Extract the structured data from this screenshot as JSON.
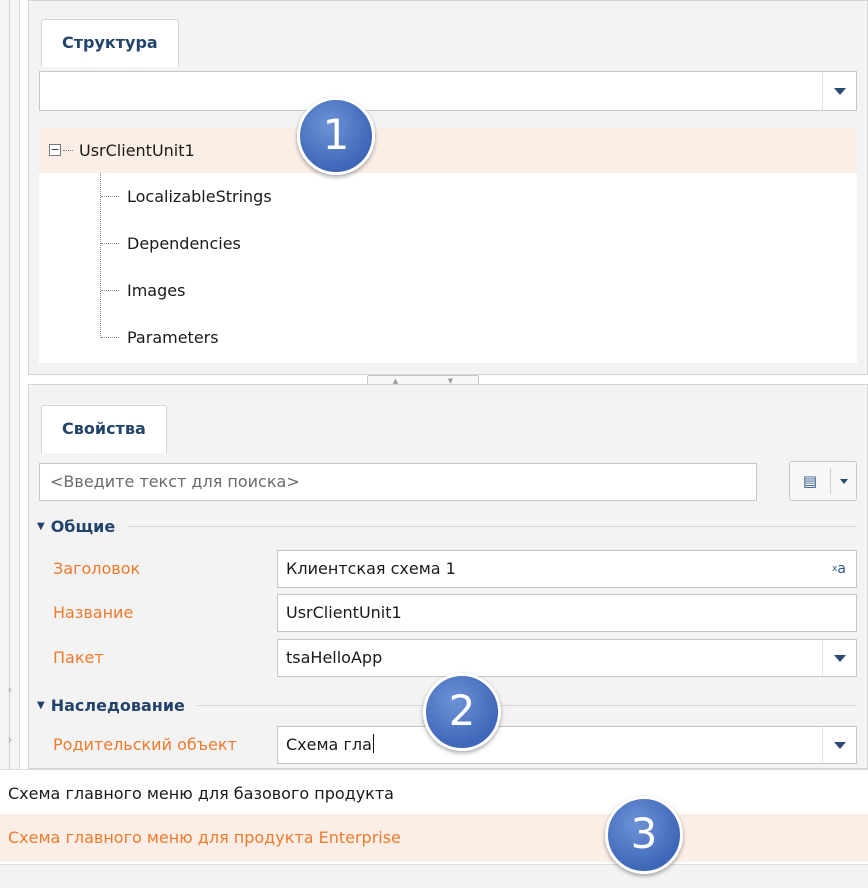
{
  "structure": {
    "tab_label": "Структура",
    "combo_value": "",
    "tree": {
      "root": "UsrClientUnit1",
      "children": [
        "LocalizableStrings",
        "Dependencies",
        "Images",
        "Parameters"
      ]
    }
  },
  "properties": {
    "tab_label": "Свойства",
    "search_placeholder": "<Введите текст для поиска>",
    "groups": {
      "general": "Общие",
      "inheritance": "Наследование"
    },
    "fields": {
      "title": {
        "label": "Заголовок",
        "value": "Клиентская схема 1"
      },
      "name": {
        "label": "Название",
        "value": "UsrClientUnit1"
      },
      "package": {
        "label": "Пакет",
        "value": "tsaHelloApp"
      },
      "parent": {
        "label": "Родительский объект",
        "value": "Схема гла"
      }
    }
  },
  "dropdown": {
    "items": [
      "Схема главного меню для базового продукта",
      "Схема главного меню для продукта Enterprise"
    ],
    "highlighted_index": 1
  },
  "callouts": [
    "1",
    "2",
    "3"
  ],
  "icons": {
    "localize": "xa-icon",
    "search_options": "properties-list-icon"
  },
  "colors": {
    "accent": "#f07a2c",
    "tab_text": "#23446a",
    "highlight": "#fbeee6",
    "badge": "#4a72c0"
  }
}
